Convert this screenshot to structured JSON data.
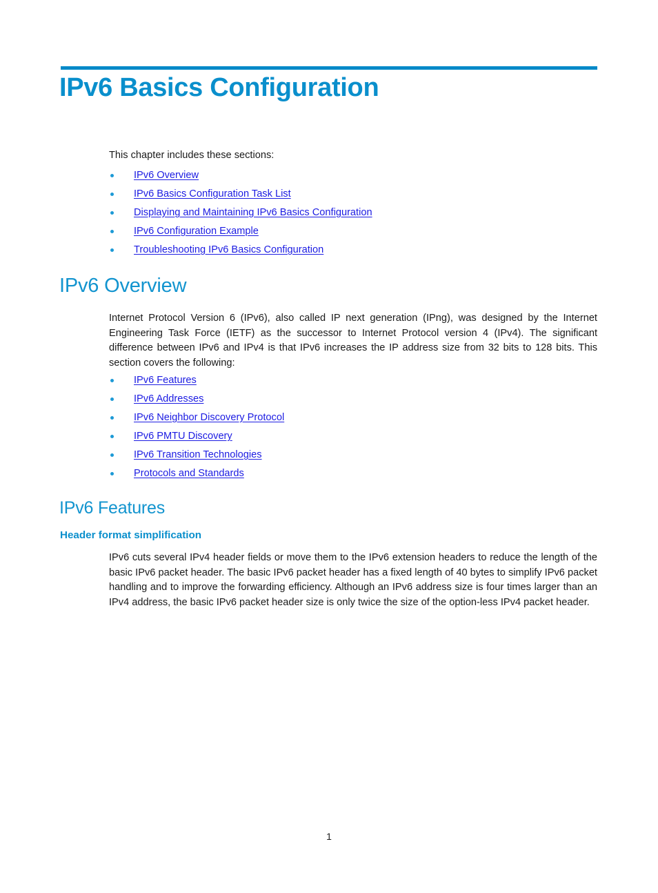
{
  "document": {
    "title": "IPv6 Basics Configuration",
    "page_number": "1"
  },
  "intro": {
    "lead": "This chapter includes these sections:",
    "sections": [
      {
        "label": "IPv6 Overview"
      },
      {
        "label": "IPv6 Basics Configuration Task List"
      },
      {
        "label": "Displaying and Maintaining IPv6 Basics Configuration"
      },
      {
        "label": "IPv6 Configuration Example"
      },
      {
        "label": "Troubleshooting IPv6 Basics Configuration"
      }
    ]
  },
  "overview": {
    "heading": "IPv6 Overview",
    "paragraph": "Internet Protocol Version 6 (IPv6), also called IP next generation (IPng), was designed by the Internet Engineering Task Force (IETF) as the successor to Internet Protocol version 4 (IPv4). The significant difference between IPv6 and IPv4 is that IPv6 increases the IP address size from 32 bits to 128 bits. This section covers the following:",
    "sections": [
      {
        "label": "IPv6 Features"
      },
      {
        "label": "IPv6 Addresses"
      },
      {
        "label": "IPv6 Neighbor Discovery Protocol"
      },
      {
        "label": "IPv6 PMTU Discovery"
      },
      {
        "label": "IPv6 Transition Technologies"
      },
      {
        "label": "Protocols and Standards"
      }
    ]
  },
  "features": {
    "heading": "IPv6 Features",
    "subheading": "Header format simplification",
    "paragraph": "IPv6 cuts several IPv4 header fields or move them to the IPv6 extension headers to reduce the length of the basic IPv6 packet header. The basic IPv6 packet header has a fixed length of 40 bytes to simplify IPv6 packet handling and to improve the forwarding efficiency. Although an IPv6 address size is four times larger than an IPv4 address, the basic IPv6 packet header size is only twice the size of the option-less IPv4 packet header."
  },
  "colors": {
    "title_blue": "#0a8fcc",
    "heading_blue": "#1294cf",
    "rule_blue": "#0089c8",
    "link_blue": "#1b1be2",
    "bullet_blue": "#1d9ad6",
    "body_text": "#1a1a1a"
  }
}
